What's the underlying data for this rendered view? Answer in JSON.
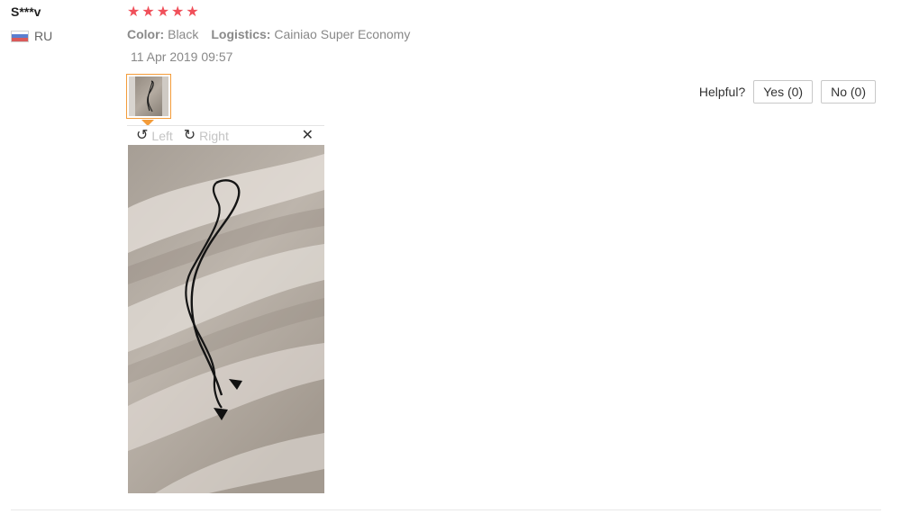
{
  "review": {
    "reviewer": "S***v",
    "country": "RU",
    "country_flag": "russia-flag",
    "rating": 5,
    "stars": [
      "★",
      "★",
      "★",
      "★",
      "★"
    ],
    "star_color": "#f0505a",
    "color_label": "Color:",
    "color_value": "Black",
    "logistics_label": "Logistics:",
    "logistics_value": "Cainiao Super Economy",
    "date": "11 Apr 2019 09:57"
  },
  "image_viewer": {
    "rotate_left_label": "Left",
    "rotate_right_label": "Right",
    "rotate_left_icon": "↺",
    "rotate_right_icon": "↻",
    "close_icon": "✕",
    "accent_color": "#f39c3a"
  },
  "helpful": {
    "label": "Helpful?",
    "yes_label": "Yes (0)",
    "no_label": "No (0)"
  }
}
